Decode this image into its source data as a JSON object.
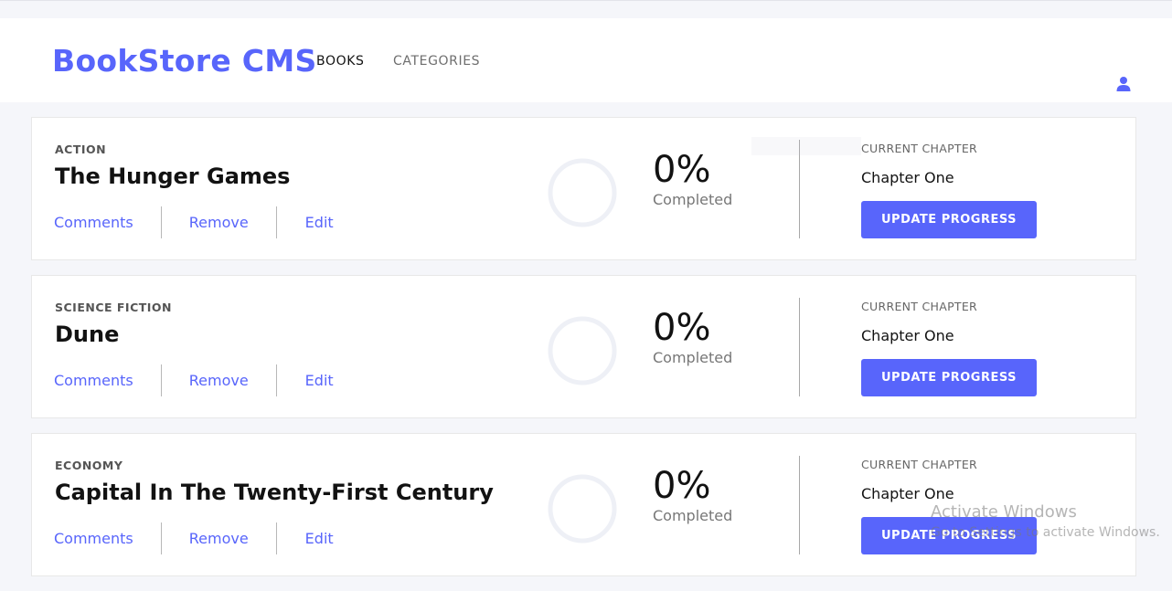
{
  "header": {
    "brand": "BookStore CMS",
    "nav": [
      {
        "label": "BOOKS",
        "active": true
      },
      {
        "label": "CATEGORIES",
        "active": false
      }
    ],
    "user_icon": "user-icon"
  },
  "colors": {
    "accent": "#5865fb",
    "background": "#f5f6fa",
    "card": "#ffffff"
  },
  "books": [
    {
      "genre": "ACTION",
      "title": "The Hunger Games",
      "actions": [
        "Comments",
        "Remove",
        "Edit"
      ],
      "percent": "0%",
      "completed_label": "Completed",
      "current_chapter_label": "CURRENT CHAPTER",
      "chapter": "Chapter One",
      "update_label": "UPDATE PROGRESS"
    },
    {
      "genre": "SCIENCE FICTION",
      "title": "Dune",
      "actions": [
        "Comments",
        "Remove",
        "Edit"
      ],
      "percent": "0%",
      "completed_label": "Completed",
      "current_chapter_label": "CURRENT CHAPTER",
      "chapter": "Chapter One",
      "update_label": "UPDATE PROGRESS"
    },
    {
      "genre": "ECONOMY",
      "title": "Capital In The Twenty-First Century",
      "actions": [
        "Comments",
        "Remove",
        "Edit"
      ],
      "percent": "0%",
      "completed_label": "Completed",
      "current_chapter_label": "CURRENT CHAPTER",
      "chapter": "Chapter One",
      "update_label": "UPDATE PROGRESS"
    }
  ],
  "watermark": {
    "line1": "Activate Windows",
    "line2": "Go to Settings to activate Windows."
  }
}
